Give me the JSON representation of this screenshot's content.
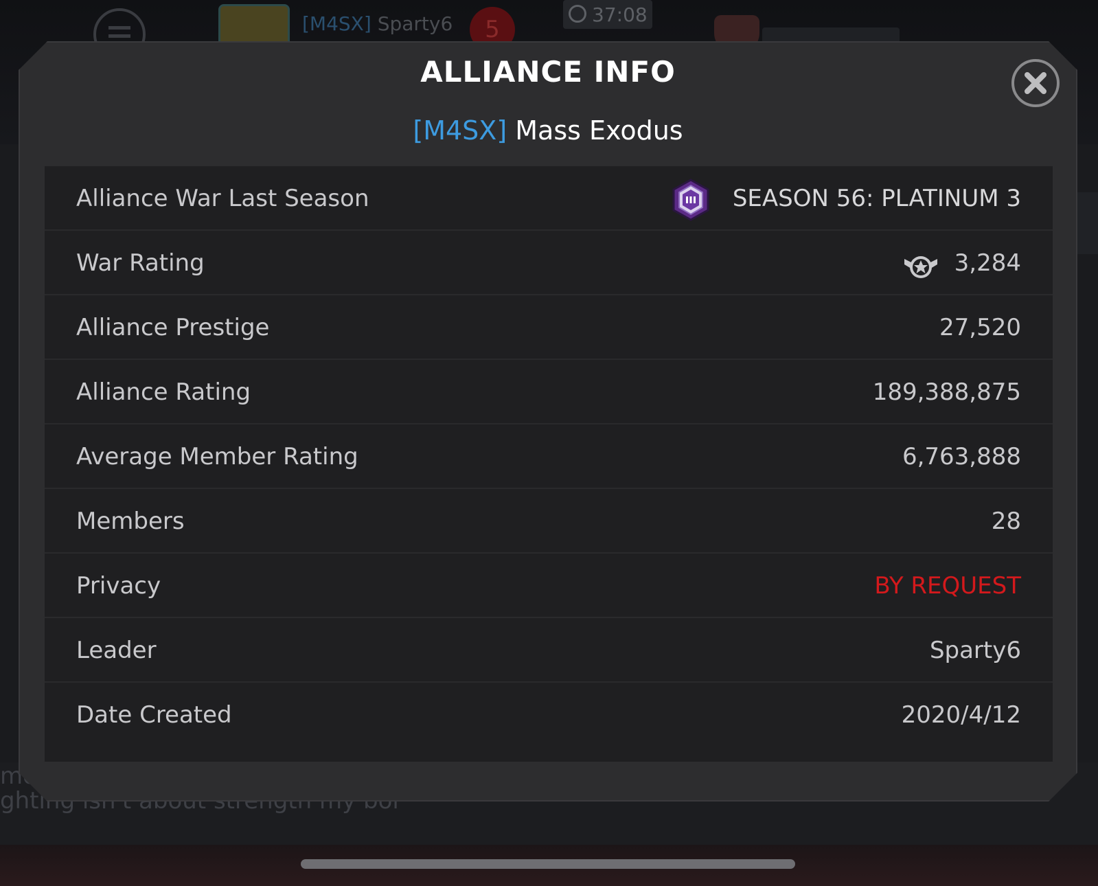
{
  "hud": {
    "player_tag": "[M4SX]",
    "player_name": "Sparty6",
    "notification_count": "5",
    "timer": "37:08"
  },
  "modal": {
    "title": "ALLIANCE INFO",
    "alliance_tag": "[M4SX]",
    "alliance_name": "Mass Exodus",
    "rows": [
      {
        "label": "Alliance War Last Season",
        "value": "SEASON 56: PLATINUM 3",
        "icon": "platinum-3-badge-icon"
      },
      {
        "label": "War Rating",
        "value": "3,284",
        "icon": "war-rating-star-icon"
      },
      {
        "label": "Alliance Prestige",
        "value": "27,520"
      },
      {
        "label": "Alliance Rating",
        "value": "189,388,875"
      },
      {
        "label": "Average Member Rating",
        "value": "6,763,888"
      },
      {
        "label": "Members",
        "value": "28"
      },
      {
        "label": "Privacy",
        "value": "BY REQUEST",
        "color": "#d3191c"
      },
      {
        "label": "Leader",
        "value": "Sparty6"
      },
      {
        "label": "Date Created",
        "value": "2020/4/12"
      }
    ]
  },
  "chat": {
    "line1": "mo",
    "line2": "ghting isn't about strength my boi"
  },
  "colors": {
    "accent_blue": "#3d9be0",
    "privacy_red": "#d3191c",
    "modal_bg": "#2d2d2f",
    "table_bg": "#1f1f21"
  }
}
